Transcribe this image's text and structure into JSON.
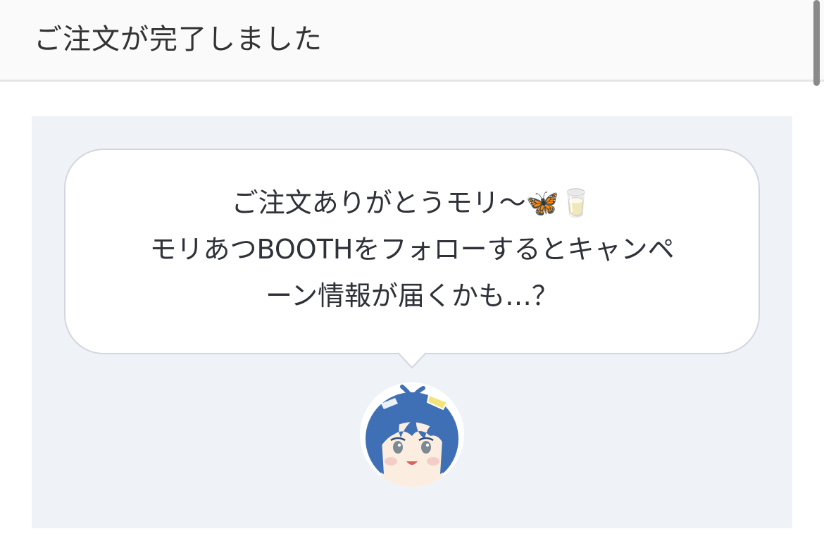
{
  "header": {
    "title": "ご注文が完了しました"
  },
  "message": {
    "line1": "ご注文ありがとうモリ〜🦋🥛",
    "line2": "モリあつBOOTHをフォローするとキャンペ",
    "line3": "ーン情報が届くかも…？"
  },
  "avatar": {
    "icon": "mascot-avatar-icon"
  },
  "colors": {
    "panel_bg": "#eff3f8",
    "bubble_border": "#d3d6df",
    "hair": "#3f6fb5"
  }
}
